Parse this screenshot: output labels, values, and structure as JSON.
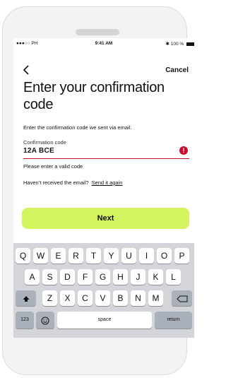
{
  "status_bar": {
    "carrier": "●●●○○ PH",
    "time": "9:41 AM",
    "battery": "100 %"
  },
  "nav": {
    "back_icon": "chevron-left-icon",
    "cancel_label": "Cancel"
  },
  "title": "Enter your confirmation code",
  "subtitle": "Enter the confirmation code we sent via email.",
  "field": {
    "label": "Confirmation code",
    "value": "12A BCE",
    "error_icon": "!",
    "error_text": "Please enter a valid code"
  },
  "resend": {
    "prompt": "Haven’t received the email?",
    "link": "Send it again"
  },
  "next_label": "Next",
  "keyboard": {
    "row1": [
      "Q",
      "W",
      "E",
      "R",
      "T",
      "Y",
      "U",
      "I",
      "O",
      "P"
    ],
    "row2": [
      "A",
      "S",
      "D",
      "F",
      "G",
      "H",
      "J",
      "K",
      "L"
    ],
    "row3": [
      "Z",
      "X",
      "C",
      "V",
      "B",
      "N",
      "M"
    ],
    "shift_icon": "shift-icon",
    "backspace_icon": "backspace-icon",
    "numbers_label": "123",
    "emoji_icon": "emoji-icon",
    "space_label": "space",
    "return_label": "return"
  },
  "colors": {
    "accent": "#d3f45e",
    "error": "#c8102e",
    "keyboard_bg": "#d3d5db"
  }
}
